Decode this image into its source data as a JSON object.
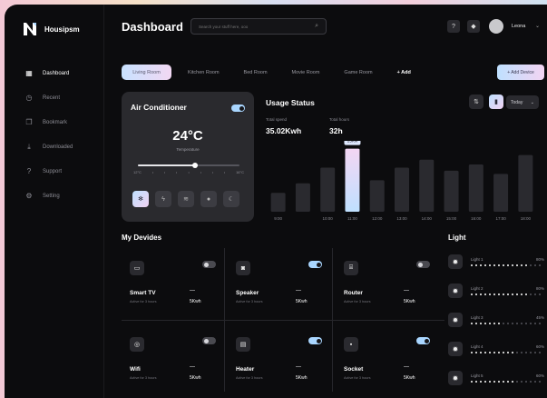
{
  "app": {
    "name": "Housipsm"
  },
  "sidebar": {
    "items": [
      {
        "label": "Dashboard",
        "icon": "grid-icon",
        "active": true
      },
      {
        "label": "Recent",
        "icon": "clock-icon"
      },
      {
        "label": "Bookmark",
        "icon": "bookmark-icon"
      },
      {
        "label": "Downloaded",
        "icon": "download-icon"
      },
      {
        "label": "Support",
        "icon": "help-icon"
      },
      {
        "label": "Setting",
        "icon": "gear-icon"
      }
    ]
  },
  "header": {
    "title": "Dashboard",
    "search_placeholder": "Search your stuff here, ooo",
    "user": "Leona"
  },
  "tabs": [
    {
      "label": "Living Room",
      "active": true
    },
    {
      "label": "Kitchen Room"
    },
    {
      "label": "Bed Room"
    },
    {
      "label": "Movie Room"
    },
    {
      "label": "Game Room"
    },
    {
      "label": "+ Add",
      "add": true
    }
  ],
  "add_device": "+ Add Device",
  "ac": {
    "title": "Air Conditioner",
    "temperature": "24°C",
    "temp_label": "Temperature",
    "min": "12°C",
    "max": "16°C",
    "level": 0.56
  },
  "usage": {
    "title": "Usage Status",
    "period": "Today",
    "stats": [
      {
        "label": "Total spend",
        "value": "35.02Kwh"
      },
      {
        "label": "Total hours",
        "value": "32h"
      }
    ]
  },
  "chart_data": {
    "type": "bar",
    "categories": [
      "9:00",
      "10:00",
      "11:00",
      "12:00",
      "13:00",
      "14:00",
      "15:00",
      "16:00",
      "17:00",
      "18:00"
    ],
    "values": [
      12,
      18,
      28,
      40,
      20,
      28,
      33,
      26,
      30,
      24,
      36
    ],
    "x": [
      "9:00",
      "",
      "10:00",
      "11:00",
      "12:00",
      "13:00",
      "14:00",
      "15:00",
      "16:00",
      "17:00",
      "18:00"
    ],
    "highlight_index": 3,
    "highlight_label": "25Kw",
    "ylim": [
      0,
      45
    ]
  },
  "devices": {
    "title": "My Devides",
    "items": [
      {
        "name": "Smart TV",
        "active": "Active for 3 hours",
        "dash": "—",
        "kwh": "5Kwh",
        "on": false,
        "icon": "tv-icon"
      },
      {
        "name": "Speaker",
        "active": "Active for 3 hours",
        "dash": "—",
        "kwh": "5Kwh",
        "on": true,
        "icon": "speaker-icon"
      },
      {
        "name": "Router",
        "active": "Active for 3 hours",
        "dash": "—",
        "kwh": "5Kwh",
        "on": false,
        "icon": "router-icon"
      },
      {
        "name": "Wifi",
        "active": "Active for 3 hours",
        "dash": "—",
        "kwh": "5Kwh",
        "on": false,
        "icon": "wifi-icon"
      },
      {
        "name": "Heater",
        "active": "Active for 3 hours",
        "dash": "—",
        "kwh": "5Kwh",
        "on": true,
        "icon": "heater-icon"
      },
      {
        "name": "Socket",
        "active": "Active for 3 hours",
        "dash": "—",
        "kwh": "5Kwh",
        "on": true,
        "icon": "socket-icon"
      }
    ]
  },
  "light": {
    "title": "Light",
    "items": [
      {
        "name": "Light 1",
        "pct": "80%",
        "level": 0.8
      },
      {
        "name": "Light 2",
        "pct": "80%",
        "level": 0.8
      },
      {
        "name": "Light 3",
        "pct": "45%",
        "level": 0.45
      },
      {
        "name": "Light 4",
        "pct": "60%",
        "level": 0.6
      },
      {
        "name": "Light 5",
        "pct": "60%",
        "level": 0.6
      }
    ]
  }
}
